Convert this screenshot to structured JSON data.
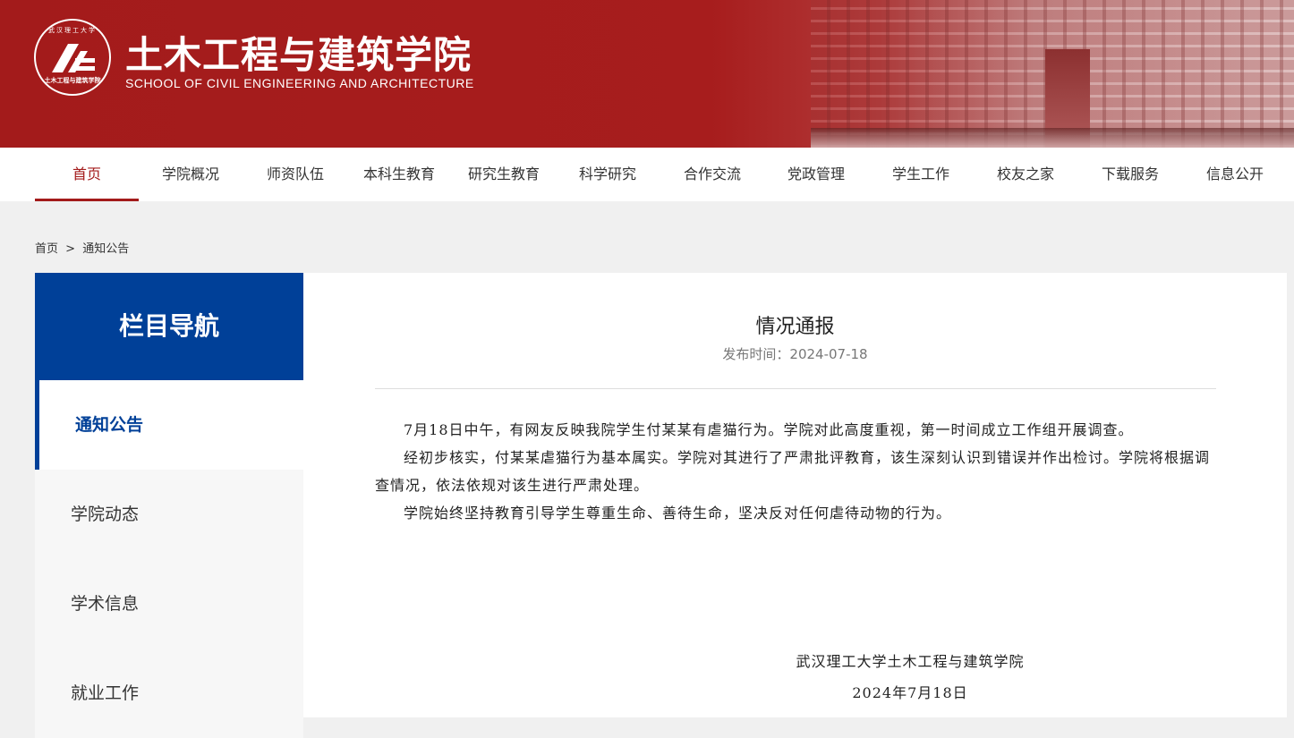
{
  "header": {
    "title": "土木工程与建筑学院",
    "subtitle": "SCHOOL OF CIVIL ENGINEERING AND ARCHITECTURE",
    "logo_text": "土木工程与建筑学院",
    "logo_arc": "武汉理工大学"
  },
  "nav": {
    "items": [
      "首页",
      "学院概况",
      "师资队伍",
      "本科生教育",
      "研究生教育",
      "科学研究",
      "合作交流",
      "党政管理",
      "学生工作",
      "校友之家",
      "下载服务",
      "信息公开"
    ],
    "active_index": 0
  },
  "breadcrumb": {
    "home": "首页",
    "separator": ">",
    "current": "通知公告"
  },
  "sidebar": {
    "heading": "栏目导航",
    "items": [
      "通知公告",
      "学院动态",
      "学术信息",
      "就业工作"
    ],
    "active_index": 0
  },
  "article": {
    "title": "情况通报",
    "date": "发布时间：2024-07-18",
    "paragraphs": [
      "7月18日中午，有网友反映我院学生付某某有虐猫行为。学院对此高度重视，第一时间成立工作组开展调查。",
      "经初步核实，付某某虐猫行为基本属实。学院对其进行了严肃批评教育，该生深刻认识到错误并作出检讨。学院将根据调查情况，依法依规对该生进行严肃处理。",
      "学院始终坚持教育引导学生尊重生命、善待生命，坚决反对任何虐待动物的行为。"
    ],
    "signature_org": "武汉理工大学土木工程与建筑学院",
    "signature_date": "2024年7月18日"
  },
  "colors": {
    "brand_red": "#a31b1b",
    "brand_blue": "#004098"
  }
}
